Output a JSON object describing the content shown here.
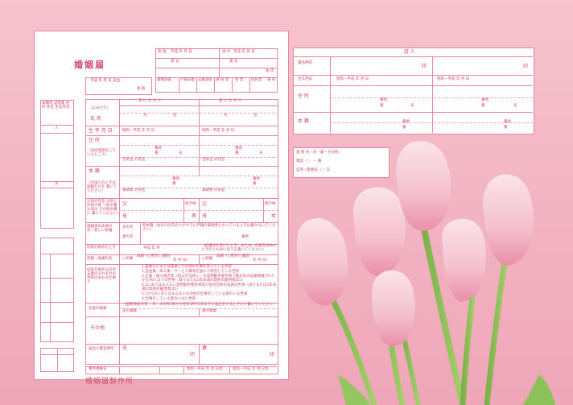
{
  "form": {
    "title": "婚姻届",
    "maker": "婚姻届製作所",
    "header": {
      "received": "受 理",
      "received_date": "平成  年  月  日",
      "number": "第        号",
      "sent": "送 付",
      "sent_date": "平成  年  月  日",
      "chief": "長 印",
      "doc_check": "書類調査",
      "register": "戸籍記載",
      "register_check": "記載調査",
      "form_notify": "調 査 票",
      "attached": "附 票",
      "resident": "住民票",
      "notice": "通 知"
    },
    "filing_date": "平成    年    月    日 届出",
    "to": "長 殿",
    "columns": {
      "husband": "夫 に な る 人",
      "wife": "妻 に な る 人"
    },
    "rows": {
      "furigana": "（よみかた）",
      "name": "氏 名",
      "family": "氏",
      "given": "名",
      "birth": "生 年 月 日",
      "birth_value": "昭和・平成    年    月    日",
      "address": "住 所",
      "address_note": "（住民登録をして いるところ）",
      "banchi": "番地",
      "ban": "番",
      "go": "号",
      "householder": "世帯主 の氏名",
      "honseki": "本 籍",
      "honseki_note": "（外国人のときは 国籍だけを 書いてください）",
      "hitto": "筆頭者 の氏名",
      "parents": "父母の氏名 父母との続き柄 （他の養父母は その他の欄に 書いてください）",
      "father": "父",
      "mother": "母",
      "relation": "続き柄",
      "son": "男",
      "daughter": "女",
      "new_family": "婚姻後の夫婦の氏・新しい本籍",
      "husband_family": "夫の氏",
      "wife_family": "妻の氏",
      "new_honseki": "新本籍（左の☑の氏の人がすでに戸籍の筆頭者となっているときは書かないでください）",
      "cohabit": "同居を始めたとき",
      "cohabit_value": "平成    年    月",
      "cohabit_note": "（結婚式をあげたとき、または、同居を始めたときのうち早いほうを書いてください）",
      "previous": "初婚・再婚の別",
      "first": "□初婚",
      "remarried": "再婚（□死別 □離別",
      "previous_date": "年  月  日）",
      "occupation": "同居を始める前の夫妻のそれぞれの世帯のおもな仕事と",
      "occupation_items": [
        "1.農業だけまたは農業とその他の仕事を持っている世帯",
        "2.自由業・商工業・サービス業等を個人で経営している世帯",
        "3.企業・個人商店等（官公庁は除く）の常用勤労者世帯で勤め先の従業者数が1人から99人までの世帯（日々または1年未満の契約の雇用者は5）",
        "4.3にあてはまらない常用勤労者世帯及び会社団体の役員の世帯（日々または1年未満の契約の雇用者は5）",
        "5.1から4にあてはまらないその他の仕事をしている者のいる世帯",
        "6.仕事をしている者のいない世帯"
      ],
      "occupation_note": "（国勢調査の年…  年…の4月1日から翌年3月31日までに届出をするときだけ書いてください）",
      "job": "夫妻の職業",
      "husband_job": "夫の職業",
      "wife_job": "妻の職業",
      "other": "その他",
      "signer": "届出人署名押印",
      "husband_sign": "夫",
      "wife_sign": "妻",
      "stamp": "印",
      "case": "事件簿番号",
      "birth_short": "昭和・平成    年    月    日生",
      "domain_label": "日中連絡のとれるところ",
      "phone": "電話（     ）    －",
      "home": "自宅・勤務先・呼出",
      "book_label": "届書数",
      "kind": "種類",
      "stamp_side": "捺印",
      "stamp2": "受付"
    },
    "witness": {
      "title": "証 人",
      "signer": "署名押印",
      "birth": "生年月日",
      "birth_value": "昭和・平成    年    月    日",
      "address": "住 所",
      "honseki": "本 籍",
      "banchi": "番地",
      "ban": "番",
      "go": "号",
      "stamp": "印"
    },
    "contact": {
      "title": "連 絡 先（夫・妻・その他）",
      "phone": "電話（     ）     －   番",
      "home": "自宅・勤務先（     ）方",
      "seal_left": "印",
      "seal_right": "印"
    },
    "left_strip": {
      "top": "本籍地 証明書 住所 氏名 生年月日",
      "h1": "人",
      "h2": "夫"
    }
  }
}
